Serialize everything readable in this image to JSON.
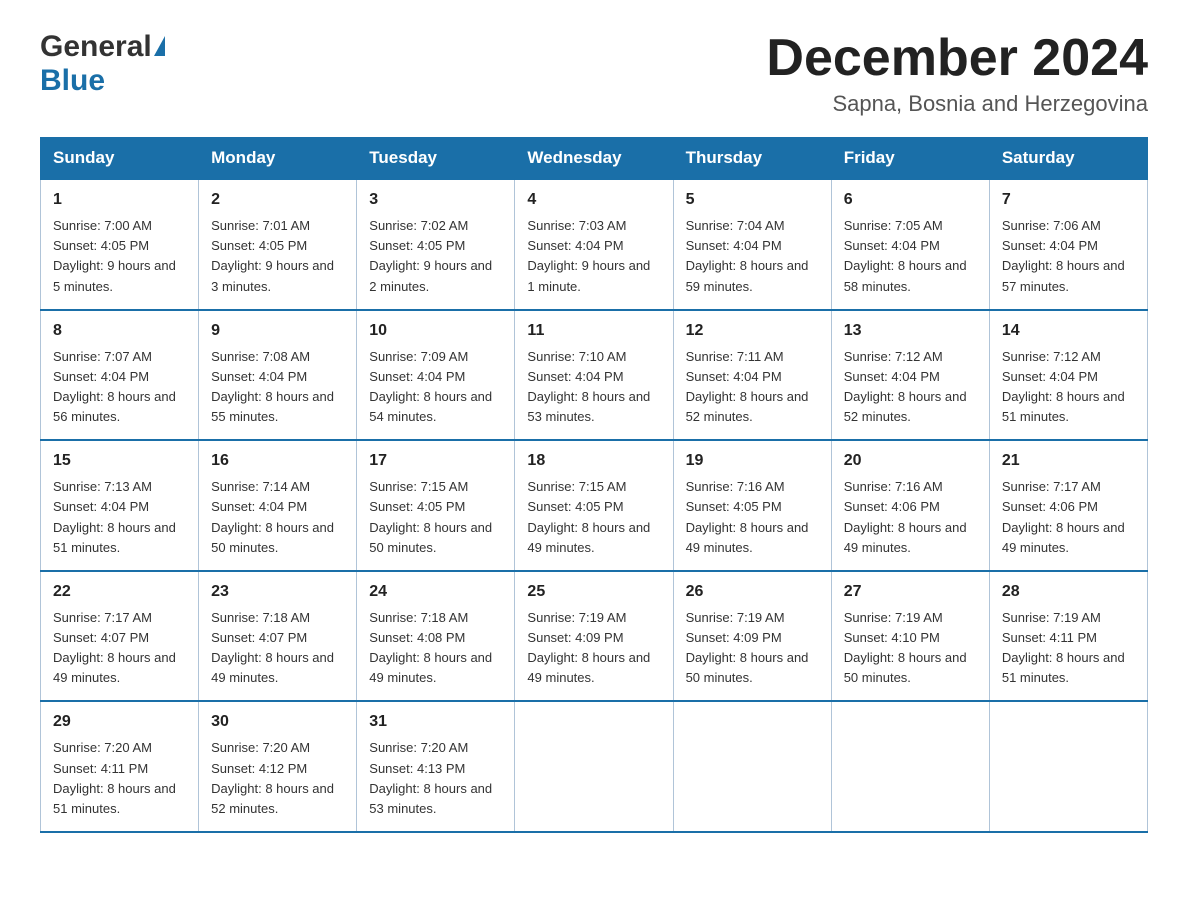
{
  "header": {
    "logo_general": "General",
    "logo_blue": "Blue",
    "month_title": "December 2024",
    "location": "Sapna, Bosnia and Herzegovina"
  },
  "days_of_week": [
    "Sunday",
    "Monday",
    "Tuesday",
    "Wednesday",
    "Thursday",
    "Friday",
    "Saturday"
  ],
  "weeks": [
    [
      {
        "day": "1",
        "sunrise": "7:00 AM",
        "sunset": "4:05 PM",
        "daylight": "9 hours and 5 minutes."
      },
      {
        "day": "2",
        "sunrise": "7:01 AM",
        "sunset": "4:05 PM",
        "daylight": "9 hours and 3 minutes."
      },
      {
        "day": "3",
        "sunrise": "7:02 AM",
        "sunset": "4:05 PM",
        "daylight": "9 hours and 2 minutes."
      },
      {
        "day": "4",
        "sunrise": "7:03 AM",
        "sunset": "4:04 PM",
        "daylight": "9 hours and 1 minute."
      },
      {
        "day": "5",
        "sunrise": "7:04 AM",
        "sunset": "4:04 PM",
        "daylight": "8 hours and 59 minutes."
      },
      {
        "day": "6",
        "sunrise": "7:05 AM",
        "sunset": "4:04 PM",
        "daylight": "8 hours and 58 minutes."
      },
      {
        "day": "7",
        "sunrise": "7:06 AM",
        "sunset": "4:04 PM",
        "daylight": "8 hours and 57 minutes."
      }
    ],
    [
      {
        "day": "8",
        "sunrise": "7:07 AM",
        "sunset": "4:04 PM",
        "daylight": "8 hours and 56 minutes."
      },
      {
        "day": "9",
        "sunrise": "7:08 AM",
        "sunset": "4:04 PM",
        "daylight": "8 hours and 55 minutes."
      },
      {
        "day": "10",
        "sunrise": "7:09 AM",
        "sunset": "4:04 PM",
        "daylight": "8 hours and 54 minutes."
      },
      {
        "day": "11",
        "sunrise": "7:10 AM",
        "sunset": "4:04 PM",
        "daylight": "8 hours and 53 minutes."
      },
      {
        "day": "12",
        "sunrise": "7:11 AM",
        "sunset": "4:04 PM",
        "daylight": "8 hours and 52 minutes."
      },
      {
        "day": "13",
        "sunrise": "7:12 AM",
        "sunset": "4:04 PM",
        "daylight": "8 hours and 52 minutes."
      },
      {
        "day": "14",
        "sunrise": "7:12 AM",
        "sunset": "4:04 PM",
        "daylight": "8 hours and 51 minutes."
      }
    ],
    [
      {
        "day": "15",
        "sunrise": "7:13 AM",
        "sunset": "4:04 PM",
        "daylight": "8 hours and 51 minutes."
      },
      {
        "day": "16",
        "sunrise": "7:14 AM",
        "sunset": "4:04 PM",
        "daylight": "8 hours and 50 minutes."
      },
      {
        "day": "17",
        "sunrise": "7:15 AM",
        "sunset": "4:05 PM",
        "daylight": "8 hours and 50 minutes."
      },
      {
        "day": "18",
        "sunrise": "7:15 AM",
        "sunset": "4:05 PM",
        "daylight": "8 hours and 49 minutes."
      },
      {
        "day": "19",
        "sunrise": "7:16 AM",
        "sunset": "4:05 PM",
        "daylight": "8 hours and 49 minutes."
      },
      {
        "day": "20",
        "sunrise": "7:16 AM",
        "sunset": "4:06 PM",
        "daylight": "8 hours and 49 minutes."
      },
      {
        "day": "21",
        "sunrise": "7:17 AM",
        "sunset": "4:06 PM",
        "daylight": "8 hours and 49 minutes."
      }
    ],
    [
      {
        "day": "22",
        "sunrise": "7:17 AM",
        "sunset": "4:07 PM",
        "daylight": "8 hours and 49 minutes."
      },
      {
        "day": "23",
        "sunrise": "7:18 AM",
        "sunset": "4:07 PM",
        "daylight": "8 hours and 49 minutes."
      },
      {
        "day": "24",
        "sunrise": "7:18 AM",
        "sunset": "4:08 PM",
        "daylight": "8 hours and 49 minutes."
      },
      {
        "day": "25",
        "sunrise": "7:19 AM",
        "sunset": "4:09 PM",
        "daylight": "8 hours and 49 minutes."
      },
      {
        "day": "26",
        "sunrise": "7:19 AM",
        "sunset": "4:09 PM",
        "daylight": "8 hours and 50 minutes."
      },
      {
        "day": "27",
        "sunrise": "7:19 AM",
        "sunset": "4:10 PM",
        "daylight": "8 hours and 50 minutes."
      },
      {
        "day": "28",
        "sunrise": "7:19 AM",
        "sunset": "4:11 PM",
        "daylight": "8 hours and 51 minutes."
      }
    ],
    [
      {
        "day": "29",
        "sunrise": "7:20 AM",
        "sunset": "4:11 PM",
        "daylight": "8 hours and 51 minutes."
      },
      {
        "day": "30",
        "sunrise": "7:20 AM",
        "sunset": "4:12 PM",
        "daylight": "8 hours and 52 minutes."
      },
      {
        "day": "31",
        "sunrise": "7:20 AM",
        "sunset": "4:13 PM",
        "daylight": "8 hours and 53 minutes."
      },
      null,
      null,
      null,
      null
    ]
  ],
  "labels": {
    "sunrise": "Sunrise:",
    "sunset": "Sunset:",
    "daylight": "Daylight:"
  }
}
